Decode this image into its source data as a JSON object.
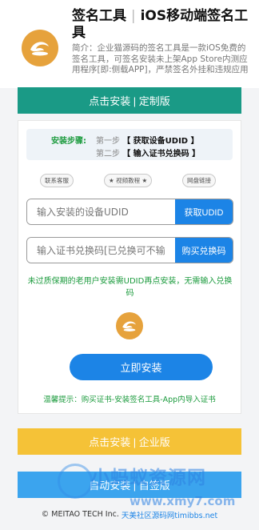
{
  "header": {
    "title_part1": "签名工具",
    "title_sep": "|",
    "title_part2": "iOS移动端签名工具",
    "description": "简介：企业猫源码的签名工具是一款iOS免费的签名工具，可签名安装未上架App Store内测应用程序[即:侧载APP]，严禁签名外挂和违规应用"
  },
  "buttons": {
    "custom_install": "点击安装 | 定制版",
    "enterprise_install": "点击安装 | 企业版",
    "auto_install": "自动安装 | 自签版"
  },
  "steps": {
    "title": "安装步骤:",
    "step1_num": "第一步",
    "step1_text": "【 获取设备UDID 】",
    "step2_num": "第二步",
    "step2_text": "【 输入证书兑换码 】"
  },
  "pills": {
    "support": "联系客服",
    "tutorial": "★ 视频教程 ★",
    "netdisk": "网盘链接"
  },
  "udid": {
    "placeholder": "输入安装的设备UDID",
    "button": "获取UDID"
  },
  "redeem": {
    "placeholder": "输入证书兑换码[已兑换可不输",
    "button": "购买兑换码"
  },
  "notice": "未过质保期的老用户安装需UDID再点安装，无需输入兑换码",
  "install_button": "立即安装",
  "tip": "温馨提示：购买证书-安装签名工具-App内导入证书",
  "watermark": {
    "title": "小蚂蚁资源网",
    "url": "www.xmy7.com"
  },
  "footer": {
    "copyright": "© MEITAO TECH Inc.",
    "link": "天美社区源码网timibbs.net"
  },
  "colors": {
    "teal": "#1a9a86",
    "blue": "#1c84e6",
    "yellow": "#f5c237",
    "green_text": "#1c9b3e",
    "logo": "#e6a23c"
  }
}
